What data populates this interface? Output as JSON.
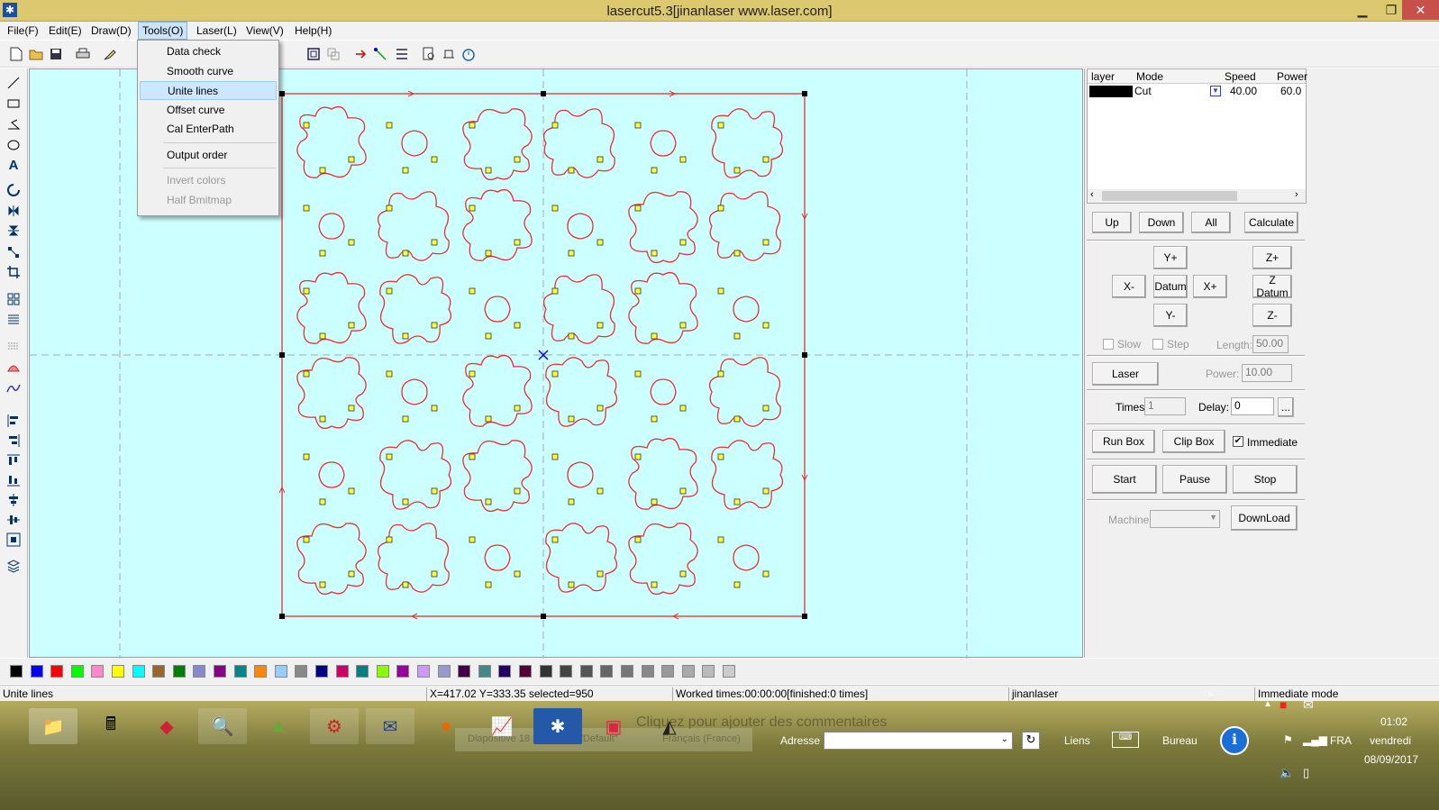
{
  "window": {
    "title": "lasercut5.3[jinanlaser www.laser.com]"
  },
  "menu": [
    {
      "label": "File(F)"
    },
    {
      "label": "Edit(E)"
    },
    {
      "label": "Draw(D)"
    },
    {
      "label": "Tools(O)"
    },
    {
      "label": "Laser(L)"
    },
    {
      "label": "View(V)"
    },
    {
      "label": "Help(H)"
    }
  ],
  "tools_menu": {
    "items": [
      {
        "label": "Data check",
        "enabled": true
      },
      {
        "label": "Smooth curve",
        "enabled": true
      },
      {
        "label": "Unite lines",
        "enabled": true,
        "highlighted": true
      },
      {
        "label": "Offset curve",
        "enabled": true
      },
      {
        "label": "Cal EnterPath",
        "enabled": true
      },
      {
        "label": "Output order",
        "enabled": true
      },
      {
        "label": "Invert colors",
        "enabled": false
      },
      {
        "label": "Half Bmitmap",
        "enabled": false
      }
    ]
  },
  "layers": {
    "headers": [
      "layer",
      "Mode",
      "Speed",
      "Power"
    ],
    "rows": [
      {
        "color": "#000000",
        "mode": "Cut",
        "speed": "40.00",
        "power": "60.0"
      }
    ]
  },
  "panel": {
    "up": "Up",
    "down": "Down",
    "all": "All",
    "calculate": "Calculate",
    "yplus": "Y+",
    "xminus": "X-",
    "datum": "Datum",
    "xplus": "X+",
    "yminus": "Y-",
    "zplus": "Z+",
    "zdatum": "Z Datum",
    "zminus": "Z-",
    "slow": "Slow",
    "step": "Step",
    "length_label": "Length:",
    "length_value": "50.00",
    "laser": "Laser",
    "power_label": "Power:",
    "power_value": "10.00",
    "times_label": "Times:",
    "times_value": "1",
    "delay_label": "Delay:",
    "delay_value": "0",
    "more": "...",
    "runbox": "Run Box",
    "clipbox": "Clip Box",
    "immediate": "Immediate",
    "start": "Start",
    "pause": "Pause",
    "stop": "Stop",
    "machine_label": "Machine:",
    "download": "DownLoad"
  },
  "palette": [
    "#000000",
    "#0000ff",
    "#ff0000",
    "#00ff00",
    "#ff88cc",
    "#ffff00",
    "#00ffff",
    "#996633",
    "#008000",
    "#8888cc",
    "#880088",
    "#008888",
    "#ff8800",
    "#99ccff",
    "#888888",
    "#000088",
    "#cc0066",
    "#008080",
    "#88ff00",
    "#990099",
    "#cc99ff",
    "#9999cc",
    "#440044",
    "#448888",
    "#220066",
    "#550033",
    "#333333",
    "#444444",
    "#555555",
    "#666666",
    "#777777",
    "#888888",
    "#999999",
    "#aaaaaa",
    "#bbbbbb",
    "#cccccc"
  ],
  "status": {
    "mode": "Unite lines",
    "coords": "X=417.02 Y=333.35 selected=950",
    "worked": "Worked times:00:00:00[finished:0 times]",
    "vendor": "jinanlaser",
    "state": "Immediate mode"
  },
  "taskbar": {
    "ghost_text": "Cliquez pour ajouter des commentaires",
    "ghost_status": [
      "Diapositive 18 sur 18",
      "\"Default\"",
      "Français (France)"
    ],
    "address_label": "Adresse",
    "links": "Liens",
    "desktop": "Bureau",
    "lang": "FRA",
    "time": "01:02",
    "day": "vendredi",
    "date": "08/09/2017",
    "chevron": "»"
  }
}
